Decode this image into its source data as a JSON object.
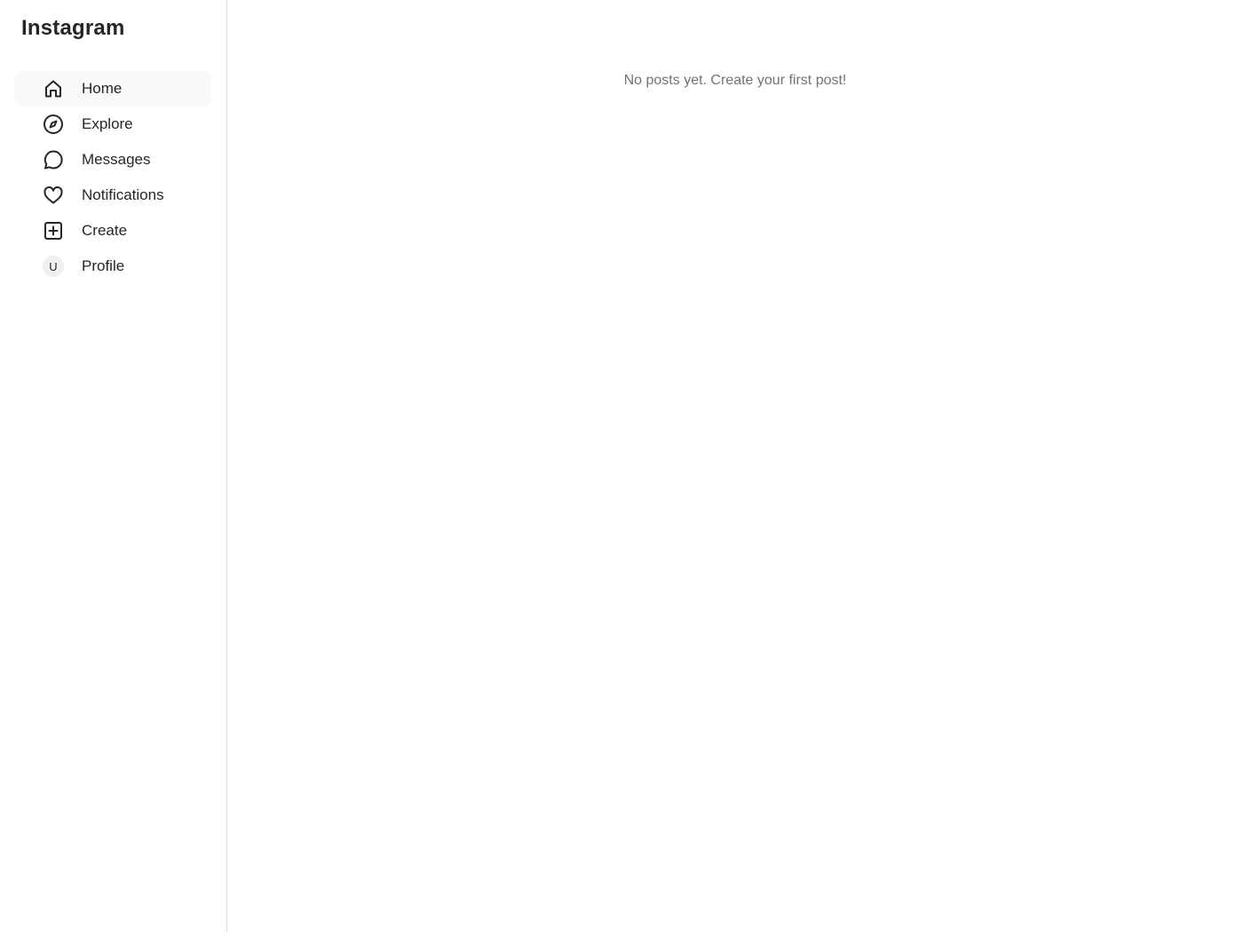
{
  "sidebar": {
    "brand": "Instagram",
    "items": [
      {
        "label": "Home",
        "icon": "home-icon",
        "active": true
      },
      {
        "label": "Explore",
        "icon": "compass-icon",
        "active": false
      },
      {
        "label": "Messages",
        "icon": "message-bubble-icon",
        "active": false
      },
      {
        "label": "Notifications",
        "icon": "heart-icon",
        "active": false
      },
      {
        "label": "Create",
        "icon": "plus-square-icon",
        "active": false
      },
      {
        "label": "Profile",
        "icon": "avatar",
        "active": false
      }
    ],
    "profile_initial": "U"
  },
  "main": {
    "empty_message": "No posts yet. Create your first post!"
  },
  "colors": {
    "text": "#262626",
    "muted": "#737373",
    "border": "#dbdbdb",
    "active_bg": "#fafafa"
  }
}
